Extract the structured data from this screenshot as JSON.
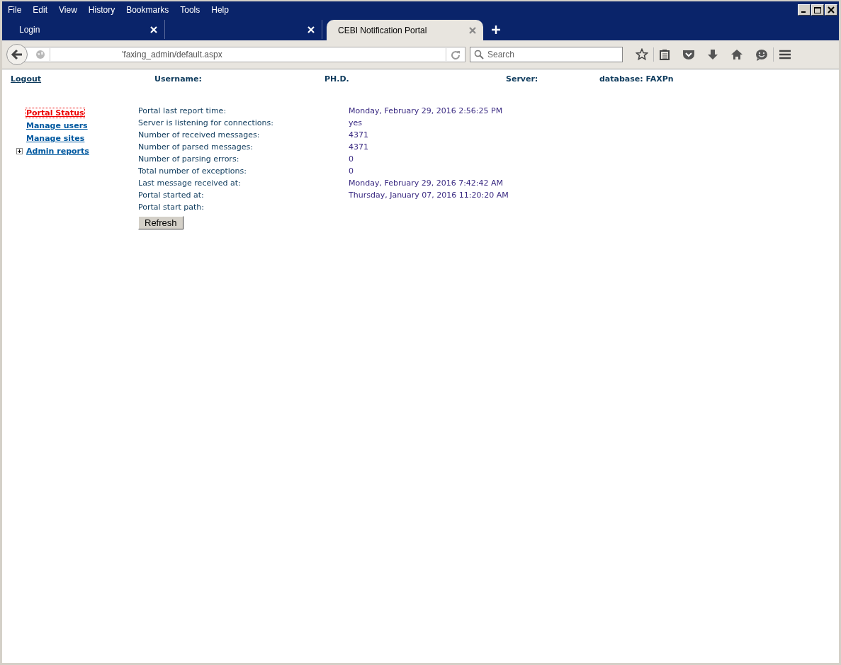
{
  "menu": [
    "File",
    "Edit",
    "View",
    "History",
    "Bookmarks",
    "Tools",
    "Help"
  ],
  "tabs": [
    {
      "label": "Login",
      "selected": false
    },
    {
      "selected": false
    },
    {
      "label": "CEBI Notification Portal",
      "selected": true
    }
  ],
  "address_bar": {
    "value": "'faxing_admin/default.aspx"
  },
  "search": {
    "placeholder": "Search"
  },
  "header": {
    "logout": "Logout",
    "fields": [
      "Username:",
      "PH.D.",
      "Server:",
      "database: FAXPn"
    ]
  },
  "sidebar": {
    "items": [
      {
        "label": "Portal Status",
        "selected": true
      },
      {
        "label": "Manage users",
        "selected": false
      },
      {
        "label": "Manage sites",
        "selected": false
      },
      {
        "label": "Admin reports",
        "selected": false,
        "expanded": false
      }
    ]
  },
  "status": [
    {
      "label": "Portal last report time:",
      "value": "Monday, February 29, 2016 2:56:25 PM"
    },
    {
      "label": "Server is listening for connections:",
      "value": "yes"
    },
    {
      "label": "Number of received messages:",
      "value": "4371"
    },
    {
      "label": "Number of parsed messages:",
      "value": "4371"
    },
    {
      "label": "Number of parsing errors:",
      "value": "0"
    },
    {
      "label": "Total number of exceptions:",
      "value": "0"
    },
    {
      "label": "Last message received at:",
      "value": "Monday, February 29, 2016 7:42:42 AM"
    },
    {
      "label": "Portal started at:",
      "value": "Thursday, January 07, 2016 11:20:20 AM"
    },
    {
      "label": "Portal start path:"
    }
  ],
  "refresh_button": "Refresh"
}
